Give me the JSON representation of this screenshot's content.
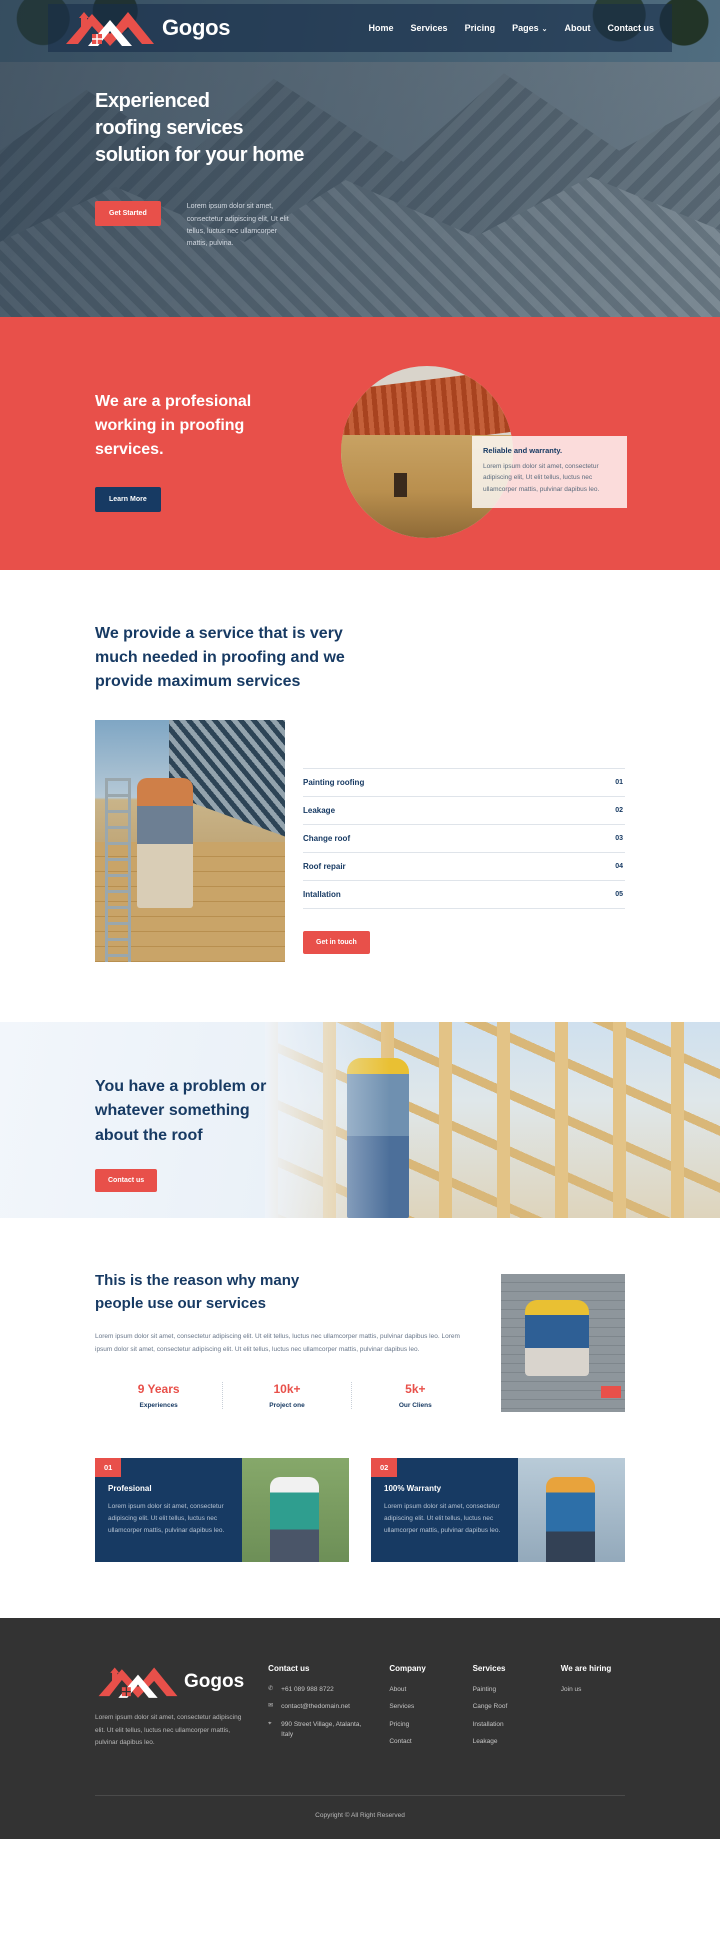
{
  "brand": {
    "name": "Gogos",
    "logo_icon": "roof-logo-icon"
  },
  "nav": {
    "items": [
      {
        "label": "Home",
        "name": "nav-home"
      },
      {
        "label": "Services",
        "name": "nav-services"
      },
      {
        "label": "Pricing",
        "name": "nav-pricing"
      },
      {
        "label": "Pages",
        "name": "nav-pages",
        "caret": "⌄"
      },
      {
        "label": "About",
        "name": "nav-about"
      },
      {
        "label": "Contact us",
        "name": "nav-contact"
      }
    ]
  },
  "hero": {
    "title_line1": "Experienced",
    "title_line2": "roofing services",
    "title_line3": "solution for your home",
    "cta": "Get Started",
    "paragraph": "Lorem ipsum dolor sit amet, consectetur adipiscing elit, Ut elit tellus, luctus nec ullamcorper mattis, pulvina."
  },
  "promo": {
    "title_line1": "We are a profesional",
    "title_line2": "working in proofing",
    "title_line3": "services.",
    "cta": "Learn More",
    "card_title": "Reliable and warranty.",
    "card_text": "Lorem ipsum dolor sit amet, consectetur adipiscing elit, Ut elit tellus, luctus nec ullamcorper mattis, pulvinar dapibus leo."
  },
  "services": {
    "title_line1": "We provide a service that is very",
    "title_line2": "much needed in proofing and we",
    "title_line3": "provide maximum services",
    "cta": "Get in touch",
    "items": [
      {
        "name": "Painting roofing",
        "number": "01"
      },
      {
        "name": "Leakage",
        "number": "02"
      },
      {
        "name": "Change roof",
        "number": "03"
      },
      {
        "name": "Roof repair",
        "number": "04"
      },
      {
        "name": "Intallation",
        "number": "05"
      }
    ]
  },
  "banner": {
    "title_line1": "You have a problem or",
    "title_line2": "whatever something",
    "title_line3": "about the roof",
    "cta": "Contact us"
  },
  "reason": {
    "title_line1": "This is the reason why many",
    "title_line2": "people use our services",
    "text": "Lorem ipsum dolor sit amet, consectetur adipiscing elit. Ut elit tellus, luctus nec ullamcorper mattis, pulvinar dapibus leo. Lorem ipsum dolor sit amet, consectetur adipiscing elit. Ut elit tellus, luctus nec ullamcorper mattis, pulvinar dapibus leo.",
    "stats": [
      {
        "value": "9 Years",
        "label": "Experiences"
      },
      {
        "value": "10k+",
        "label": "Project one"
      },
      {
        "value": "5k+",
        "label": "Our Cliens"
      }
    ]
  },
  "cards": [
    {
      "badge": "01",
      "title": "Profesional",
      "text": "Lorem ipsum dolor sit amet, consectetur adipiscing elit. Ut elit tellus, luctus nec ullamcorper mattis, pulvinar dapibus leo."
    },
    {
      "badge": "02",
      "title": "100% Warranty",
      "text": "Lorem ipsum dolor sit amet, consectetur adipiscing elit. Ut elit tellus, luctus nec ullamcorper mattis, pulvinar dapibus leo."
    }
  ],
  "footer": {
    "brand_name": "Gogos",
    "about": "Lorem ipsum dolor sit amet, consectetur adipiscing elit. Ut elit tellus, luctus nec ullamcorper mattis, pulvinar dapibus leo.",
    "contact": {
      "heading": "Contact us",
      "items": [
        {
          "icon": "phone-icon",
          "glyph": "✆",
          "text": "+61 089 988 8722"
        },
        {
          "icon": "mail-icon",
          "glyph": "✉",
          "text": "contact@thedomain.net"
        },
        {
          "icon": "location-icon",
          "glyph": "⌖",
          "text": "990 Street Village, Atalanta, Italy"
        }
      ]
    },
    "company": {
      "heading": "Company",
      "items": [
        "About",
        "Services",
        "Pricing",
        "Contact"
      ]
    },
    "services": {
      "heading": "Services",
      "items": [
        "Painting",
        "Cange Roof",
        "Installation",
        "Leakage"
      ]
    },
    "hiring": {
      "heading": "We are hiring",
      "items": [
        "Join us"
      ]
    },
    "copyright": "Copyright © All Right Reserved"
  },
  "colors": {
    "accent": "#e8504a",
    "navy": "#173a63",
    "footer_bg": "#333333"
  }
}
